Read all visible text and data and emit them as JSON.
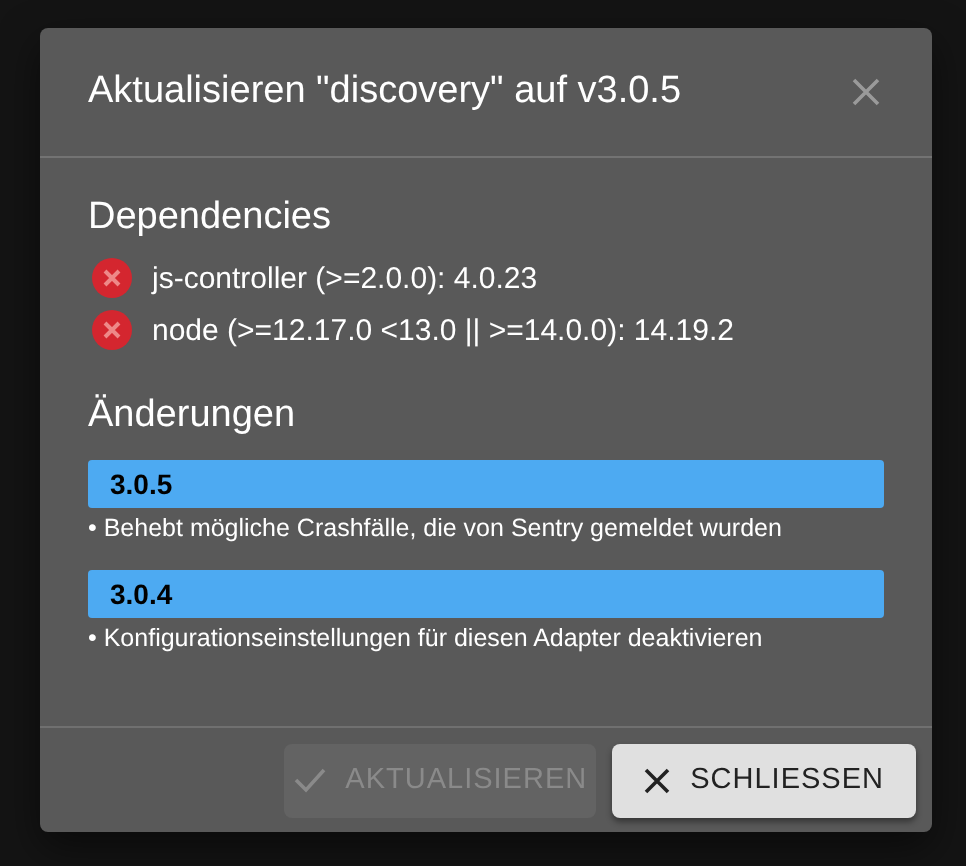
{
  "dialog": {
    "title": "Aktualisieren \"discovery\" auf v3.0.5"
  },
  "dependencies": {
    "heading": "Dependencies",
    "items": [
      {
        "text": "js-controller (>=2.0.0): 4.0.23",
        "ok": false
      },
      {
        "text": "node (>=12.17.0 <13.0 || >=14.0.0): 14.19.2",
        "ok": false
      }
    ]
  },
  "changes": {
    "heading": "Änderungen",
    "items": [
      {
        "version": "3.0.5",
        "notes": [
          "• Behebt mögliche Crashfälle, die von Sentry gemeldet wurden"
        ]
      },
      {
        "version": "3.0.4",
        "notes": [
          "• Konfigurationseinstellungen für diesen Adapter deaktivieren"
        ]
      }
    ]
  },
  "buttons": [
    {
      "kind": "update",
      "label": "AKTUALISIEREN",
      "disabled": true
    },
    {
      "kind": "close",
      "label": "SCHLIESSEN",
      "disabled": false
    }
  ]
}
